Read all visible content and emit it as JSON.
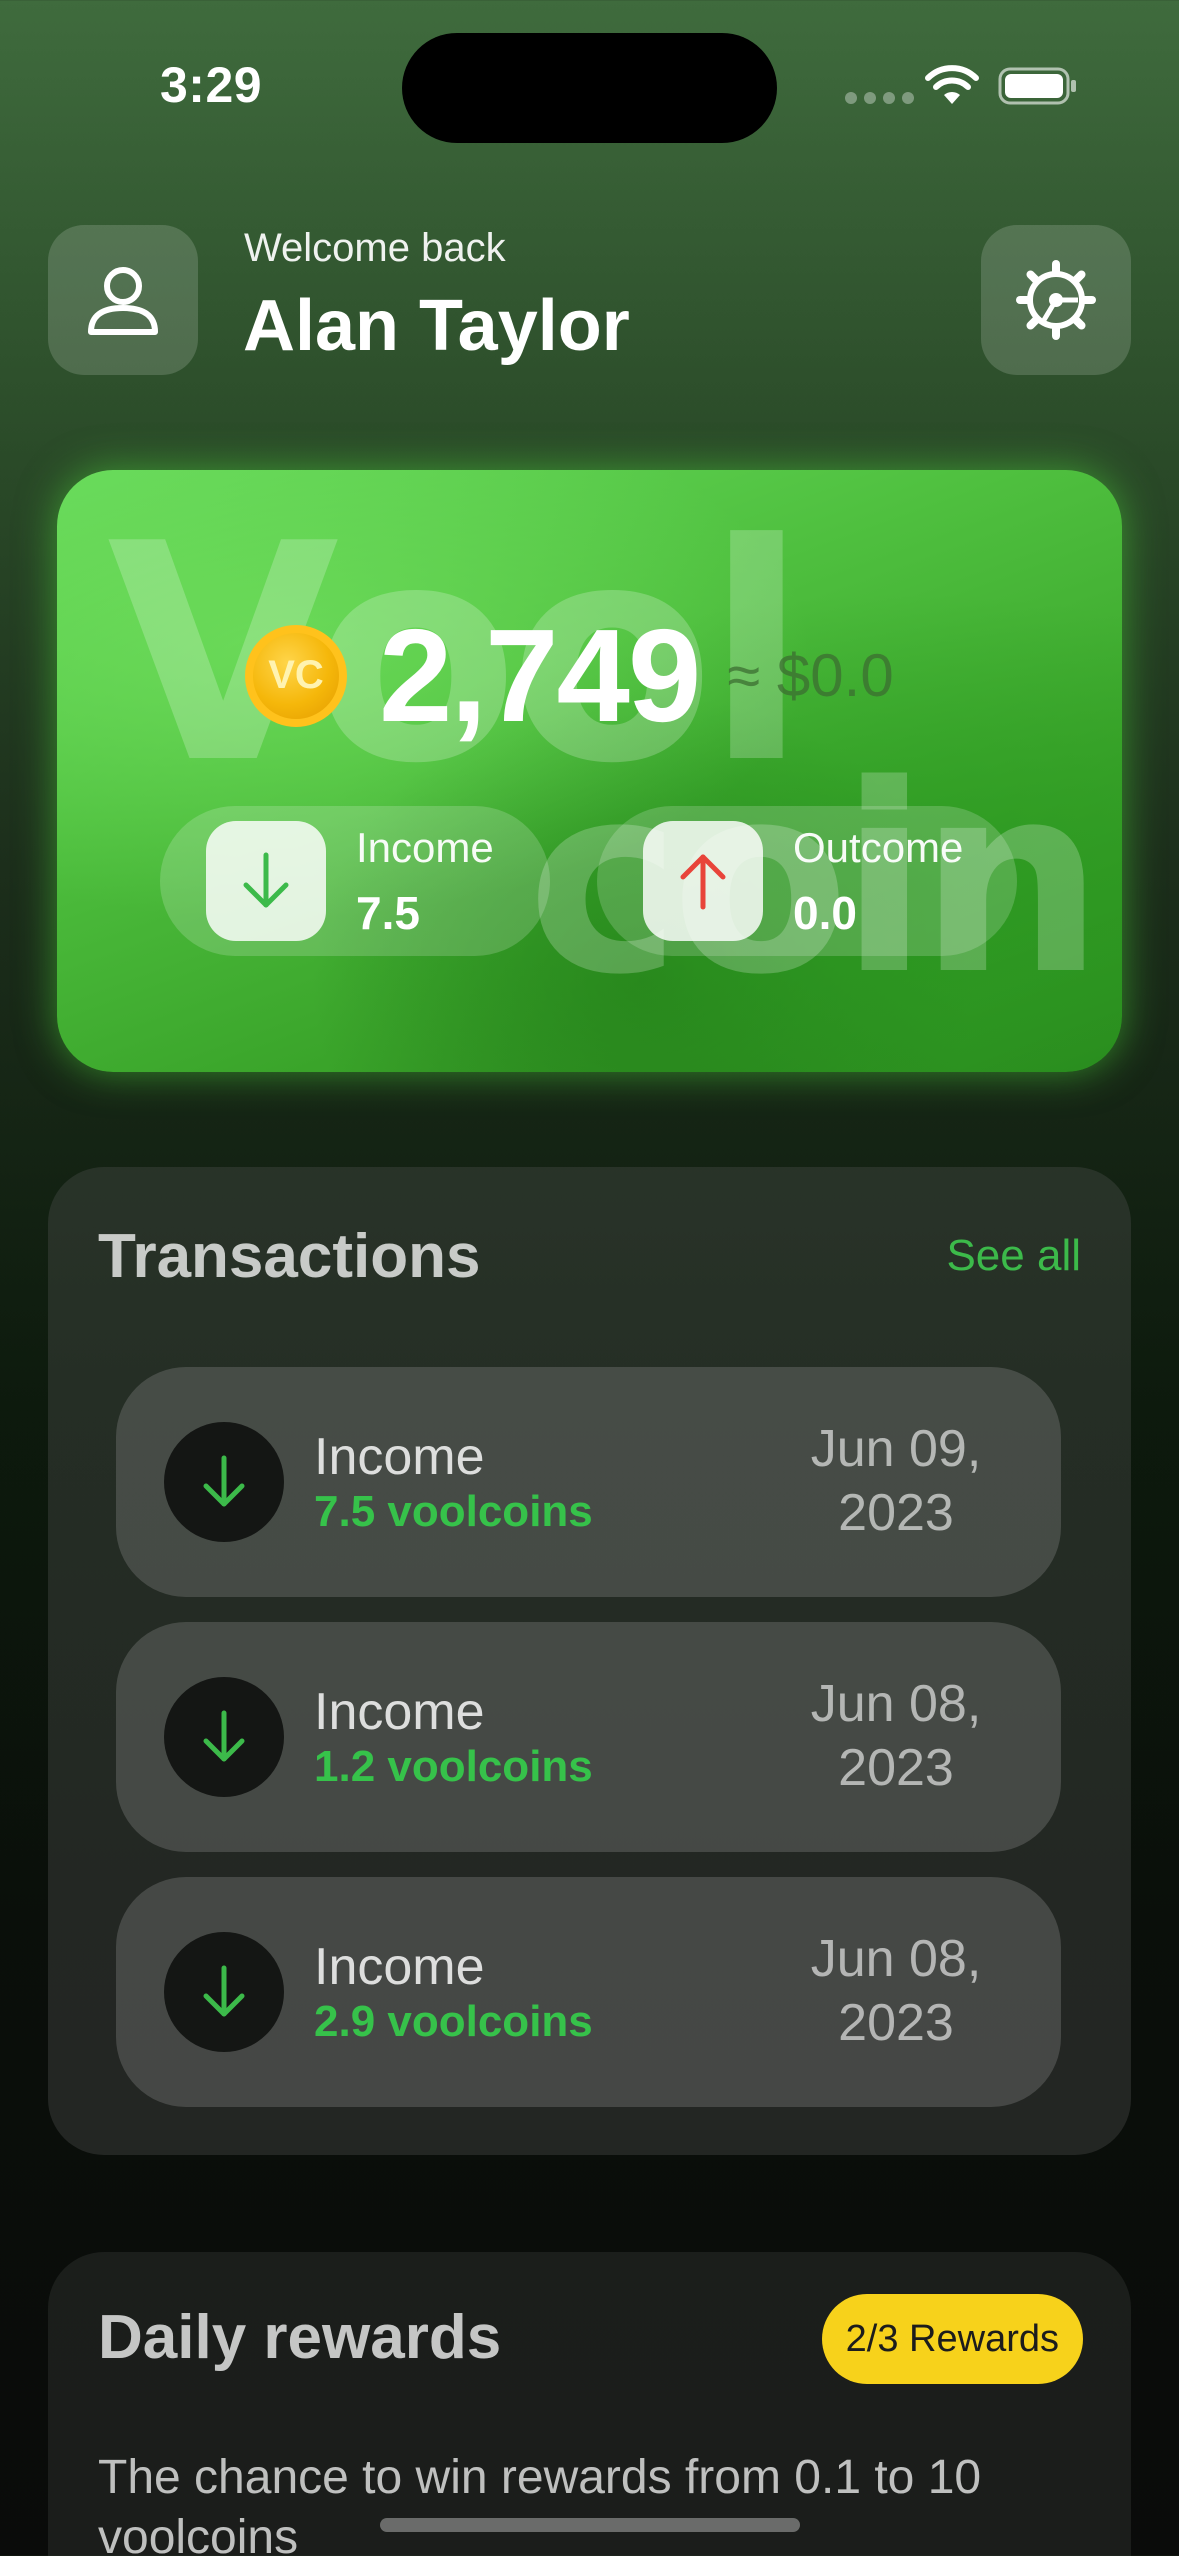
{
  "status_bar": {
    "time": "3:29"
  },
  "header": {
    "welcome": "Welcome back",
    "user_name": "Alan Taylor"
  },
  "balance": {
    "amount": "2,749",
    "usd": "≈ $0.0",
    "watermark_top": "Vool",
    "watermark_bottom": "coin",
    "coin_mark": "VC",
    "income": {
      "label": "Income",
      "value": "7.5"
    },
    "outcome": {
      "label": "Outcome",
      "value": "0.0"
    }
  },
  "transactions": {
    "title": "Transactions",
    "see_all": "See all",
    "items": [
      {
        "label": "Income",
        "amount": "7.5 voolcoins",
        "date_line1": "Jun 09,",
        "date_line2": "2023"
      },
      {
        "label": "Income",
        "amount": "1.2 voolcoins",
        "date_line1": "Jun 08,",
        "date_line2": "2023"
      },
      {
        "label": "Income",
        "amount": "2.9 voolcoins",
        "date_line1": "Jun 08,",
        "date_line2": "2023"
      }
    ]
  },
  "daily_rewards": {
    "title": "Daily rewards",
    "badge": "2/3 Rewards",
    "description": "The chance to win rewards from 0.1 to 10 voolcoins"
  },
  "colors": {
    "accent_green": "#36c24a",
    "income_arrow": "#3cba4a",
    "outcome_arrow": "#e8443a",
    "badge_yellow": "#f7d21b"
  },
  "icons": [
    "person-icon",
    "gear-icon",
    "coin-icon",
    "arrow-down-icon",
    "arrow-up-icon",
    "wifi-icon",
    "battery-icon"
  ]
}
